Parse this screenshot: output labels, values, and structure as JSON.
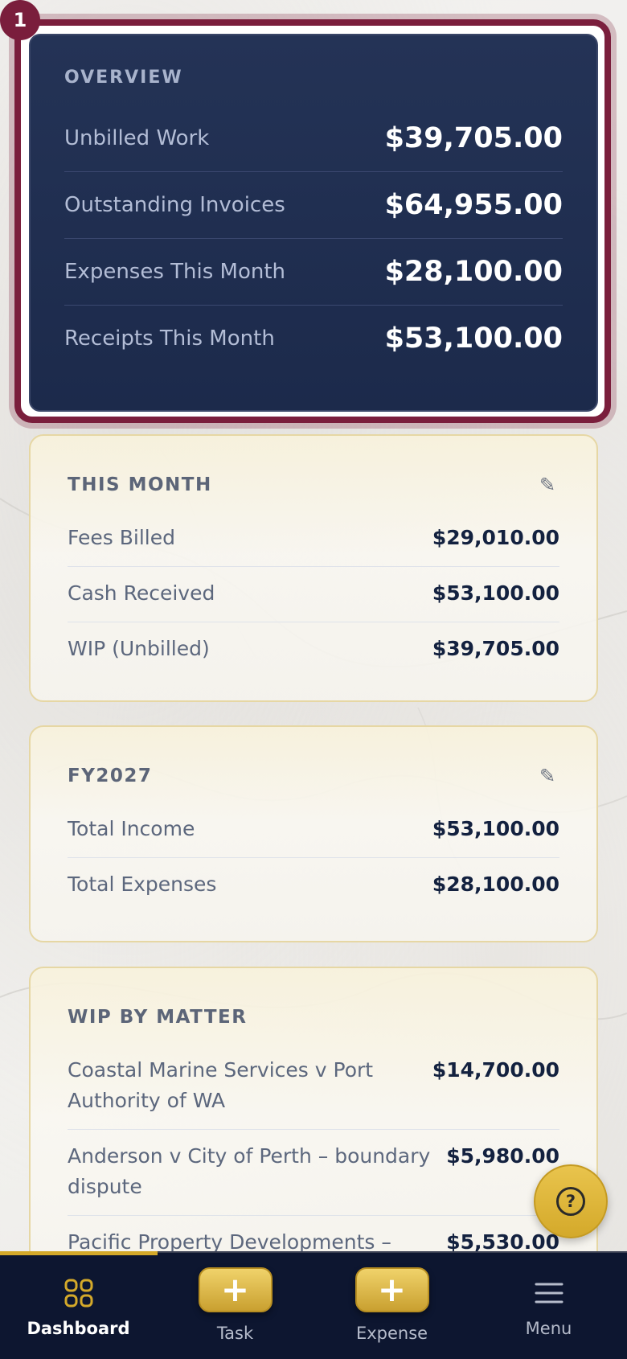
{
  "overview": {
    "badge": "1",
    "label": "OVERVIEW",
    "rows": [
      {
        "name": "Unbilled Work",
        "value": "$39,705.00"
      },
      {
        "name": "Outstanding Invoices",
        "value": "$64,955.00"
      },
      {
        "name": "Expenses This Month",
        "value": "$28,100.00"
      },
      {
        "name": "Receipts This Month",
        "value": "$53,100.00"
      }
    ]
  },
  "this_month": {
    "title": "THIS MONTH",
    "rows": [
      {
        "name": "Fees Billed",
        "value": "$29,010.00"
      },
      {
        "name": "Cash Received",
        "value": "$53,100.00"
      },
      {
        "name": "WIP (Unbilled)",
        "value": "$39,705.00"
      }
    ]
  },
  "fy": {
    "title": "FY2027",
    "rows": [
      {
        "name": "Total Income",
        "value": "$53,100.00"
      },
      {
        "name": "Total Expenses",
        "value": "$28,100.00"
      }
    ]
  },
  "wip": {
    "title": "WIP BY MATTER",
    "rows": [
      {
        "name": "Coastal Marine Services v Port Authority of WA",
        "value": "$14,700.00"
      },
      {
        "name": "Anderson v City of Perth – boundary dispute",
        "value": "$5,980.00"
      },
      {
        "name": "Pacific Property Developments –",
        "value": "$5,530.00"
      }
    ]
  },
  "help": {
    "symbol": "?"
  },
  "nav": {
    "dashboard": "Dashboard",
    "task": "Task",
    "expense": "Expense",
    "menu": "Menu",
    "plus": "+"
  },
  "colors": {
    "accent": "#d4a92a",
    "navy": "#1c2a4b",
    "burgundy": "#7a1e3c"
  }
}
